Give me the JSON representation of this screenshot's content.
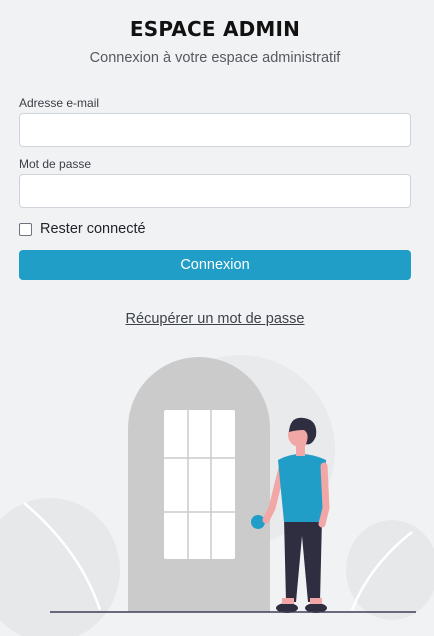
{
  "header": {
    "title": "ESPACE ADMIN",
    "subtitle": "Connexion à votre espace administratif"
  },
  "form": {
    "email_label": "Adresse e-mail",
    "email_value": "",
    "password_label": "Mot de passe",
    "password_value": "",
    "remember_label": "Rester connecté",
    "remember_checked": false,
    "submit_label": "Connexion",
    "recover_link": "Récupérer un mot de passe"
  },
  "colors": {
    "background": "#f1f2f4",
    "accent": "#209ec7",
    "door": "#cbcbcb",
    "person_shirt": "#209ec7",
    "person_pants": "#2f2e41",
    "skin": "#f2a7a7"
  }
}
